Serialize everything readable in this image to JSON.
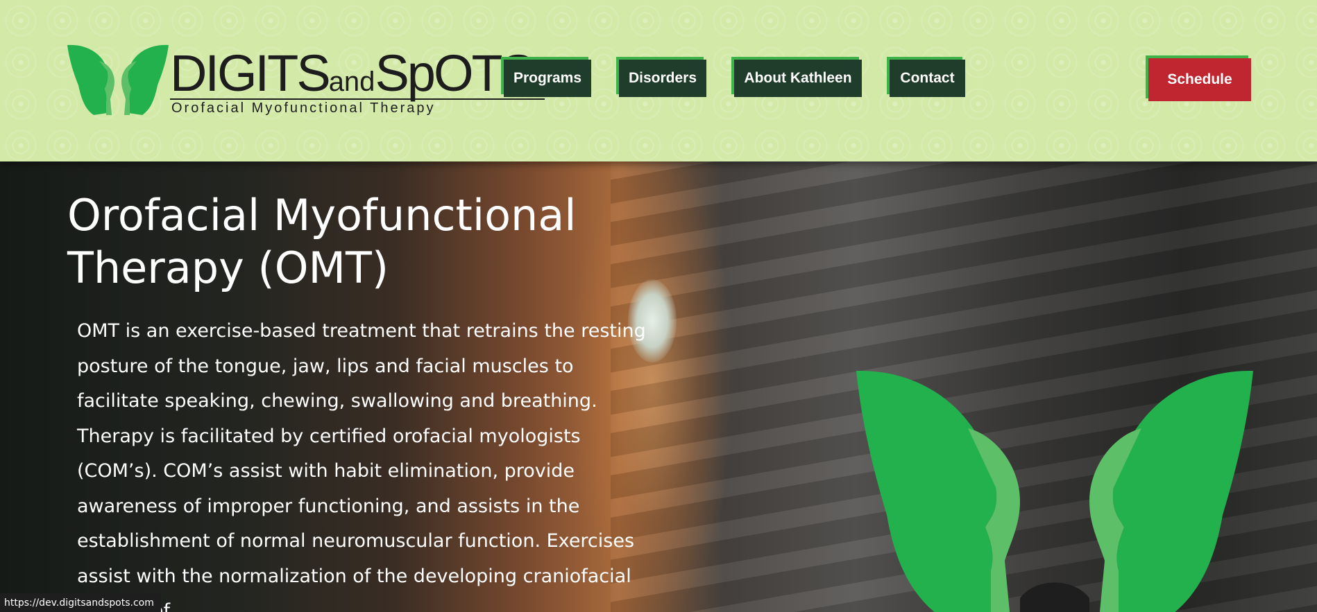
{
  "header": {
    "logo": {
      "main_part1": "DIGITS",
      "main_part2": "and",
      "main_part3": "SpOTS",
      "subtitle": "Orofacial Myofunctional Therapy"
    },
    "nav": [
      {
        "label": "Programs"
      },
      {
        "label": "Disorders"
      },
      {
        "label": "About Kathleen"
      },
      {
        "label": "Contact"
      }
    ],
    "schedule_label": "Schedule"
  },
  "hero": {
    "title": "Orofacial Myofunctional Therapy (OMT)",
    "body": "OMT is an exercise-based treatment that retrains the resting posture of the tongue, jaw, lips and facial muscles to facilitate speaking, chewing, swallowing and breathing. Therapy is facilitated by certified orofacial myologists (COM’s). COM’s assist with habit elimination, provide awareness of improper functioning, and assists in the establishment of normal neuromuscular function. Exercises assist with the normalization of the developing craniofacial regions of"
  },
  "status_bar": {
    "url": "https://dev.digitsandspots.com"
  },
  "colors": {
    "header_bg": "#d3e9a8",
    "nav_bg": "#1f3d2a",
    "accent_green": "#3fb24a",
    "schedule_red": "#c0262f",
    "logo_green_dark": "#22b14c",
    "logo_green_light": "#5dbf67"
  }
}
